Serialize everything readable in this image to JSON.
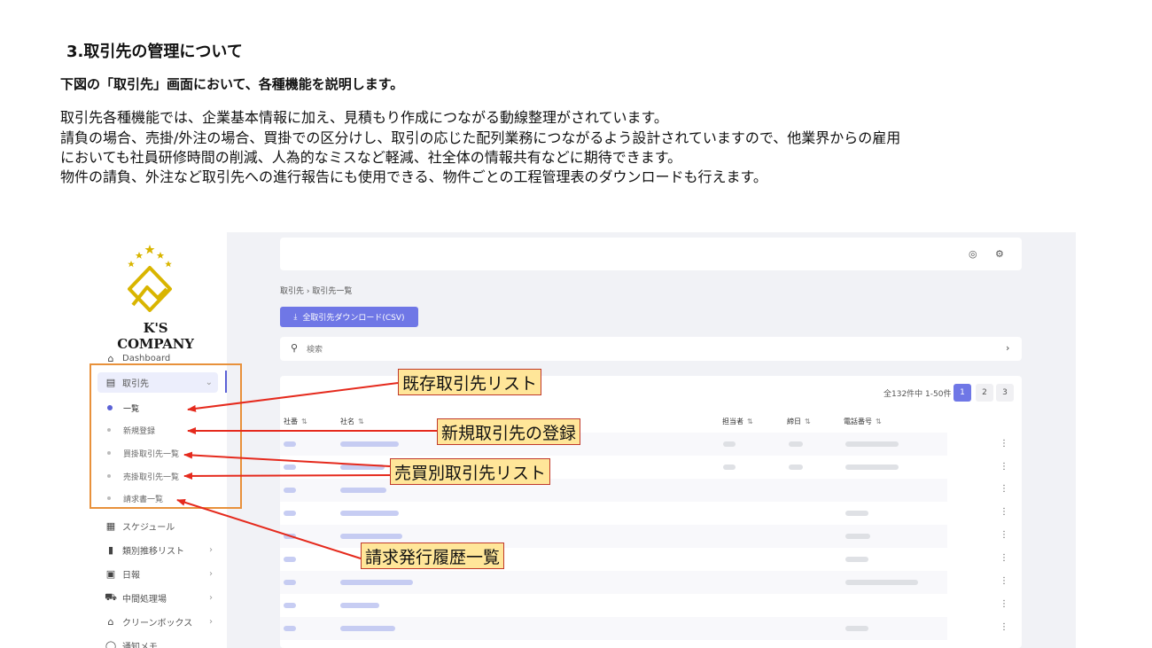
{
  "doc": {
    "title": "3.取引先の管理について",
    "subtitle": "下図の「取引先」画面において、各種機能を説明します。",
    "paragraphs": [
      "取引先各種機能では、企業基本情報に加え、見積もり作成につながる動線整理がされています。",
      "請負の場合、売掛/外注の場合、買掛での区分けし、取引の応じた配列業務につながるよう設計されていますので、他業界からの雇用",
      "においても社員研修時間の削減、人為的なミスなど軽減、社全体の情報共有などに期待できます。",
      "物件の請負、外注など取引先への進行報告にも使用できる、物件ごとの工程管理表のダウンロードも行えます。"
    ]
  },
  "app": {
    "brand": "K'S COMPANY",
    "nav": {
      "dashboard": "Dashboard",
      "torihikisaki": "取引先",
      "sub": [
        "一覧",
        "新規登録",
        "買掛取引先一覧",
        "売掛取引先一覧",
        "請求書一覧"
      ],
      "schedule": "スケジュール",
      "ruibetsu": "類別推移リスト",
      "nippou": "日報",
      "chukan": "中間処理場",
      "clean": "クリーンボックス",
      "tsuchi": "通知メモ"
    },
    "breadcrumb": "取引先 › 取引先一覧",
    "download_button": "全取引先ダウンロード(CSV)",
    "search_placeholder": "検索",
    "count": "全132件中 1-50件",
    "pages": [
      "1",
      "2",
      "3"
    ],
    "columns": [
      "社番",
      "社名",
      "担当者",
      "締日",
      "電話番号"
    ]
  },
  "callouts": {
    "existing": "既存取引先リスト",
    "new": "新規取引先の登録",
    "trade": "売買別取引先リスト",
    "invoice": "請求発行履歴一覧"
  },
  "colors": {
    "accent": "#6f77e6",
    "highlight_border": "#e8913b",
    "arrow": "#e52a1d",
    "callout_fill": "#ffe699"
  }
}
